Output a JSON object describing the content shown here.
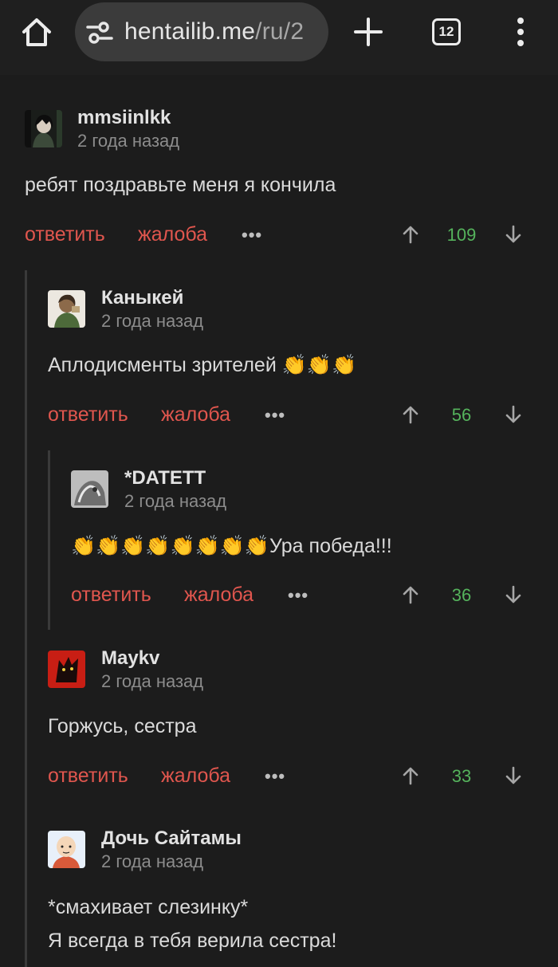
{
  "browser": {
    "url_main": "hentailib.me",
    "url_path": "/ru/2",
    "tab_count": "12",
    "icons": [
      "home-icon",
      "tune-icon",
      "plus-icon",
      "tabs-icon",
      "more-vert-icon"
    ]
  },
  "actions": {
    "reply": "ответить",
    "report": "жалоба",
    "more": "•••"
  },
  "comments": [
    {
      "user": "mmsiinlkk",
      "time": "2 года назад",
      "text": "ребят поздравьте меня я кончила",
      "score": "109"
    },
    {
      "user": "Каныкей",
      "time": "2 года назад",
      "text": "Аплодисменты зрителей 👏👏👏",
      "score": "56"
    },
    {
      "user": "*DATETT",
      "time": "2 года назад",
      "text": "👏👏👏👏👏👏👏👏Ура победа!!!",
      "score": "36"
    },
    {
      "user": "Maykv",
      "time": "2 года назад",
      "text": "Горжусь, сестра",
      "score": "33"
    },
    {
      "user": "Дочь Сайтамы",
      "time": "2 года назад",
      "text_line1": "*смахивает слезинку*",
      "text_line2": "Я всегда в тебя верила сестра!"
    }
  ],
  "colors": {
    "background": "#1c1c1c",
    "action_red": "#e0564e",
    "score_green": "#55b35c",
    "urlbar": "#3b3b3b"
  }
}
